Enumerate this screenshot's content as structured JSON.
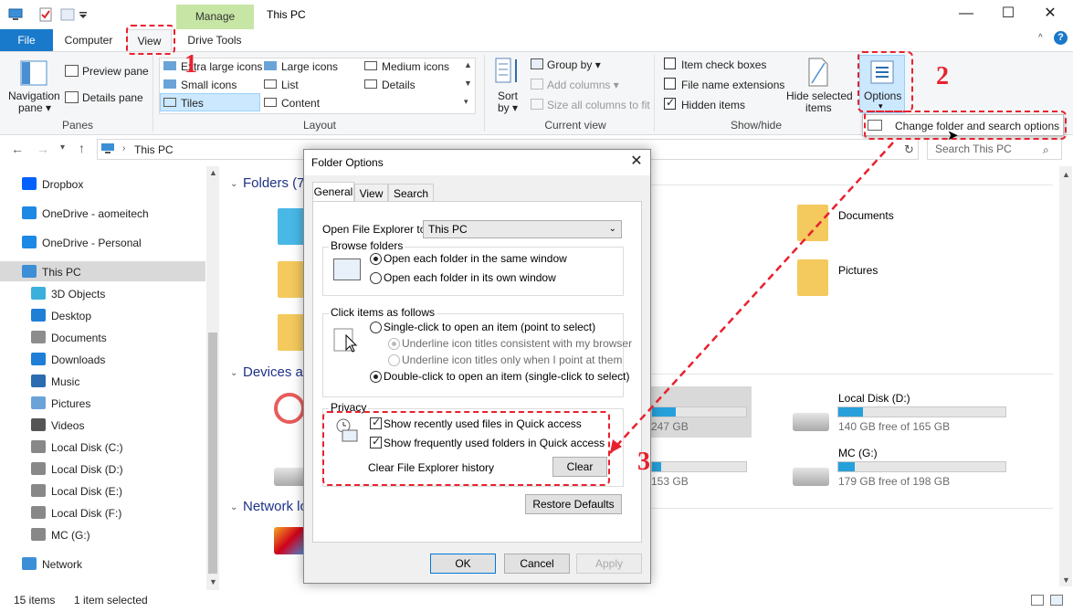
{
  "window": {
    "title": "This PC",
    "manage_tab": "Manage",
    "min_glyph": "—",
    "max_glyph": "☐",
    "close_glyph": "✕"
  },
  "ribbon_tabs": [
    "File",
    "Computer",
    "View",
    "Drive Tools"
  ],
  "ribbon": {
    "panes": {
      "navigation_pane": "Navigation",
      "navigation_pane2": "pane ▾",
      "preview_pane": "Preview pane",
      "details_pane": "Details pane",
      "group": "Panes"
    },
    "layout": {
      "items": [
        "Extra large icons",
        "Large icons",
        "Medium icons",
        "Small icons",
        "List",
        "Details",
        "Tiles",
        "Content"
      ],
      "selected": "Tiles",
      "group": "Layout"
    },
    "current_view": {
      "sort_by": "Sort",
      "sort_by2": "by ▾",
      "group_by": "Group by ▾",
      "add_columns": "Add columns ▾",
      "size_columns": "Size all columns to fit",
      "group": "Current view"
    },
    "show_hide": {
      "item_check_boxes": "Item check boxes",
      "file_name_extensions": "File name extensions",
      "hidden_items": "Hidden items",
      "hide_selected": "Hide selected",
      "hide_selected2": "items",
      "group": "Show/hide"
    },
    "options": {
      "label": "Options",
      "dropdown_item": "Change folder and search options"
    }
  },
  "address": {
    "path": "This PC",
    "search_placeholder": "Search This PC"
  },
  "nav": {
    "items": [
      "Dropbox",
      "OneDrive - aomeitech",
      "OneDrive - Personal",
      "This PC",
      "3D Objects",
      "Desktop",
      "Documents",
      "Downloads",
      "Music",
      "Pictures",
      "Videos",
      "Local Disk (C:)",
      "Local Disk (D:)",
      "Local Disk (E:)",
      "Local Disk (F:)",
      "MC (G:)",
      "Network"
    ],
    "selected": "This PC"
  },
  "content": {
    "folders_header": "Folders (7)",
    "devices_header": "Devices ar",
    "network_header": "Network lo",
    "folders": [
      "Documents",
      "Pictures"
    ],
    "drives": [
      {
        "name": "Local Disk (D:)",
        "free": "140 GB free of 165 GB",
        "used_fraction": 0.15
      },
      {
        "name": "MC (G:)",
        "free": "179 GB free of 198 GB",
        "used_fraction": 0.1
      }
    ],
    "partial_drives": [
      {
        "text": "247 GB",
        "used_fraction": 0.25
      },
      {
        "text": "153 GB",
        "used_fraction": 0.1
      }
    ]
  },
  "status": {
    "count": "15 items",
    "selected": "1 item selected"
  },
  "dialog": {
    "title": "Folder Options",
    "tabs": [
      "General",
      "View",
      "Search"
    ],
    "open_explorer_label": "Open File Explorer to:",
    "open_explorer_value": "This PC",
    "browse_folders": {
      "label": "Browse folders",
      "options": [
        "Open each folder in the same window",
        "Open each folder in its own window"
      ],
      "selected_index": 0
    },
    "click_items": {
      "label": "Click items as follows",
      "single_click": "Single-click to open an item (point to select)",
      "underline_browser": "Underline icon titles consistent with my browser",
      "underline_point": "Underline icon titles only when I point at them",
      "double_click": "Double-click to open an item (single-click to select)"
    },
    "privacy": {
      "label": "Privacy",
      "recent_files": "Show recently used files in Quick access",
      "frequent_folders": "Show frequently used folders in Quick access",
      "clear_history": "Clear File Explorer history",
      "clear_button": "Clear"
    },
    "restore_defaults": "Restore Defaults",
    "ok": "OK",
    "cancel": "Cancel",
    "apply": "Apply"
  },
  "annotations": {
    "step1": "1",
    "step2": "2",
    "step3": "3",
    "color": "#e8212e"
  }
}
